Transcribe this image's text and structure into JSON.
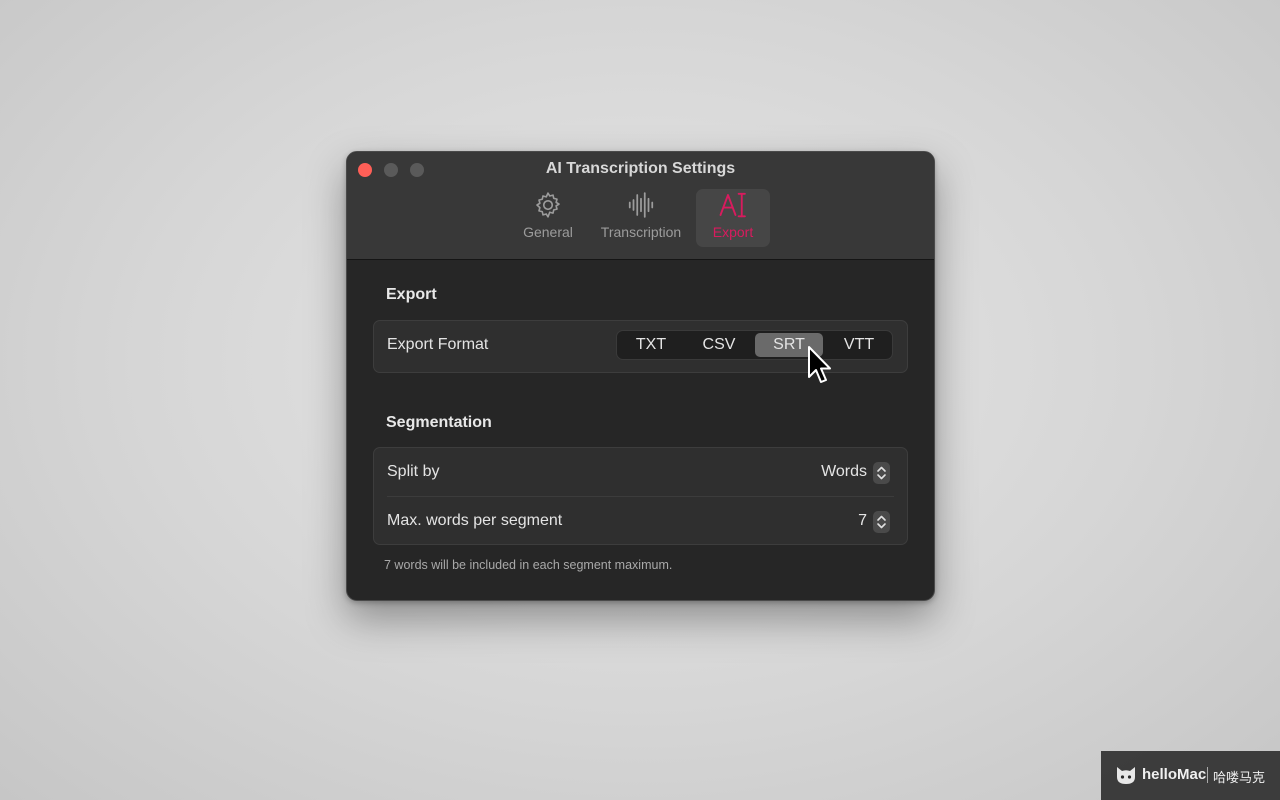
{
  "window": {
    "title": "AI Transcription Settings",
    "tabs": [
      {
        "id": "general",
        "label": "General",
        "icon": "gear-icon"
      },
      {
        "id": "transcription",
        "label": "Transcription",
        "icon": "waveform-icon"
      },
      {
        "id": "export",
        "label": "Export",
        "icon": "ai-text-cursor-icon",
        "selected": true
      }
    ]
  },
  "export_section": {
    "title": "Export",
    "format_label": "Export Format",
    "formats": [
      "TXT",
      "CSV",
      "SRT",
      "VTT"
    ],
    "selected_format": "SRT"
  },
  "segmentation": {
    "title": "Segmentation",
    "split_by_label": "Split by",
    "split_by_value": "Words",
    "max_words_label": "Max. words per segment",
    "max_words_value": "7",
    "footnote": "7 words will be included in each segment maximum."
  },
  "watermark": {
    "brand": "helloMac",
    "chinese": "哈喽马克"
  },
  "colors": {
    "accent": "#d81b5e",
    "close_button": "#ff5f57"
  }
}
